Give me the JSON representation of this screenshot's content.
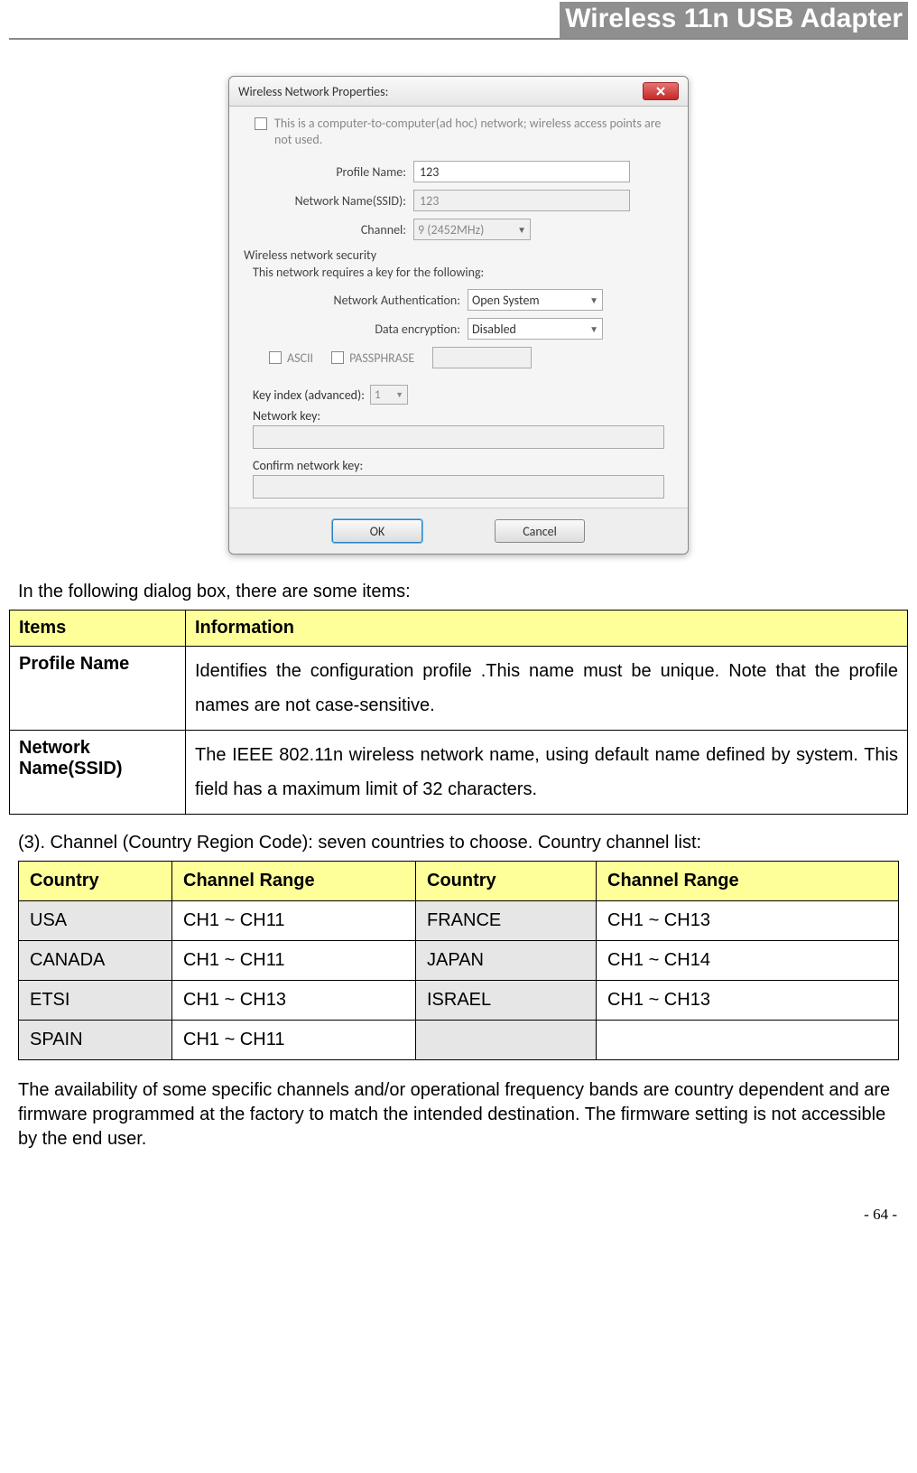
{
  "header": {
    "title": "Wireless 11n USB Adapter"
  },
  "dialog": {
    "title": "Wireless Network Properties:",
    "adhoc_label": "This is a computer-to-computer(ad hoc) network; wireless access points are not used.",
    "profile_name_label": "Profile Name:",
    "profile_name_value": "123",
    "ssid_label": "Network Name(SSID):",
    "ssid_value": "123",
    "channel_label": "Channel:",
    "channel_value": "9 (2452MHz)",
    "security_header": "Wireless network security",
    "security_sub": "This network requires a key for the following:",
    "auth_label": "Network Authentication:",
    "auth_value": "Open System",
    "enc_label": "Data encryption:",
    "enc_value": "Disabled",
    "ascii_label": "ASCII",
    "passphrase_label": "PASSPHRASE",
    "key_index_label": "Key index (advanced):",
    "key_index_value": "1",
    "network_key_label": "Network key:",
    "confirm_key_label": "Confirm network key:",
    "ok_label": "OK",
    "cancel_label": "Cancel"
  },
  "intro_text": "In the following dialog box, there are some items:",
  "items_table": {
    "headers": {
      "items": "Items",
      "info": "Information"
    },
    "rows": [
      {
        "item": "Profile Name",
        "info": "Identifies the configuration profile .This name must be unique. Note that the profile names are not case-sensitive."
      },
      {
        "item": "Network Name(SSID)",
        "info": "The IEEE 802.11n wireless network name, using default name defined by system. This field has a maximum limit of 32 characters."
      }
    ]
  },
  "channel_intro": "(3). Channel (Country Region Code): seven countries to choose. Country channel list:",
  "channel_table": {
    "headers": {
      "country": "Country",
      "range": "Channel Range"
    },
    "rows": [
      {
        "country1": "USA",
        "range1": "CH1 ~ CH11",
        "country2": "FRANCE",
        "range2": "CH1 ~ CH13"
      },
      {
        "country1": "CANADA",
        "range1": "CH1 ~ CH11",
        "country2": "JAPAN",
        "range2": "CH1 ~ CH14"
      },
      {
        "country1": "ETSI",
        "range1": "CH1 ~ CH13",
        "country2": "ISRAEL",
        "range2": "CH1 ~ CH13"
      },
      {
        "country1": "SPAIN",
        "range1": "CH1 ~ CH11",
        "country2": "",
        "range2": ""
      }
    ]
  },
  "availability_note": "The availability of some specific channels and/or operational frequency bands are country dependent and are firmware programmed at the factory to match the intended destination. The firmware setting is not accessible by the end user.",
  "page_num": "- 64 -"
}
